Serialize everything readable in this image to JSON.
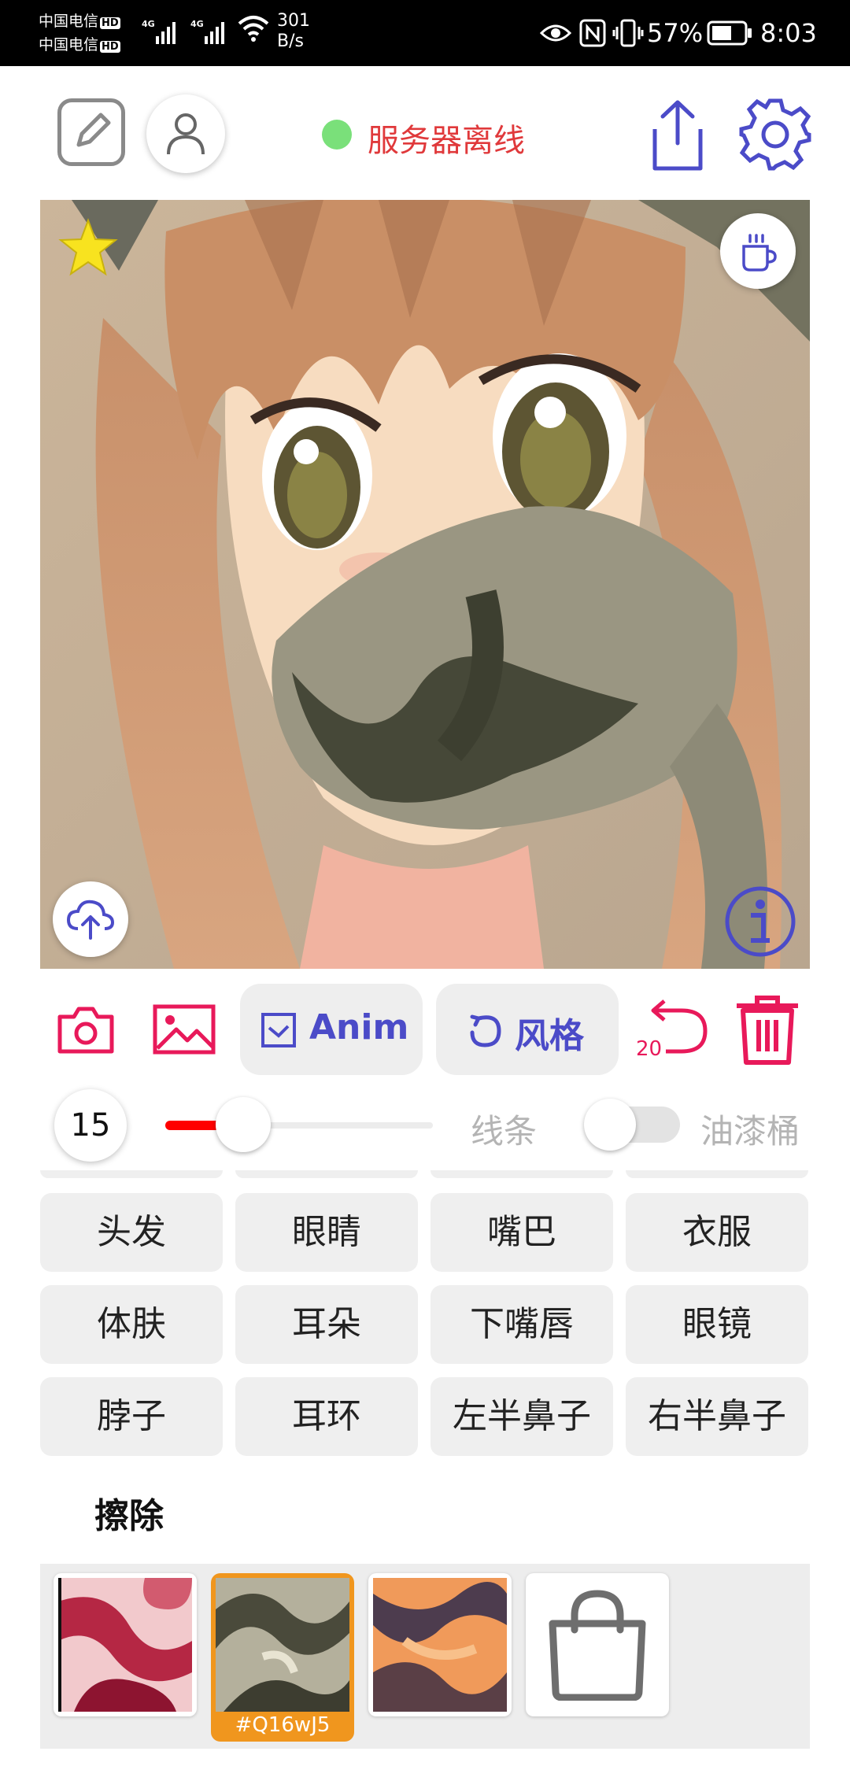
{
  "status_bar": {
    "carrier_1": "中国电信",
    "carrier_2": "中国电信",
    "hd": "HD",
    "net_type": "4G",
    "speed_value": "301",
    "speed_unit": "B/s",
    "battery": "57%",
    "time": "8:03"
  },
  "header": {
    "server_status": "服务器离线",
    "server_status_color": "#7ae07a",
    "icons": [
      "edit-icon",
      "user-icon",
      "share-icon",
      "gear-icon"
    ]
  },
  "canvas": {
    "icons": [
      "star-icon",
      "coffee-icon",
      "cloud-upload-icon",
      "info-icon"
    ]
  },
  "toolbar": {
    "anim_label": "Anim",
    "style_label": "风格",
    "undo_count": "20",
    "icons": [
      "camera-icon",
      "image-icon",
      "checkbox-icon",
      "refresh-icon",
      "undo-icon",
      "trash-icon"
    ]
  },
  "brush": {
    "size": "15",
    "line_label": "线条",
    "bucket_label": "油漆桶",
    "slider_fraction": 0.29,
    "bucket_toggle_on": false
  },
  "categories": [
    "头发",
    "眼睛",
    "嘴巴",
    "衣服",
    "体肤",
    "耳朵",
    "下嘴唇",
    "眼镜",
    "脖子",
    "耳环",
    "左半鼻子",
    "右半鼻子"
  ],
  "erase_label": "擦除",
  "swatches": {
    "selected_label": "#Q16wJ5",
    "icons": [
      "bag-icon"
    ]
  },
  "colors": {
    "accent": "#4b4bc8",
    "danger": "#e8195a",
    "slider": "#ff0000",
    "selected": "#f0961e"
  }
}
